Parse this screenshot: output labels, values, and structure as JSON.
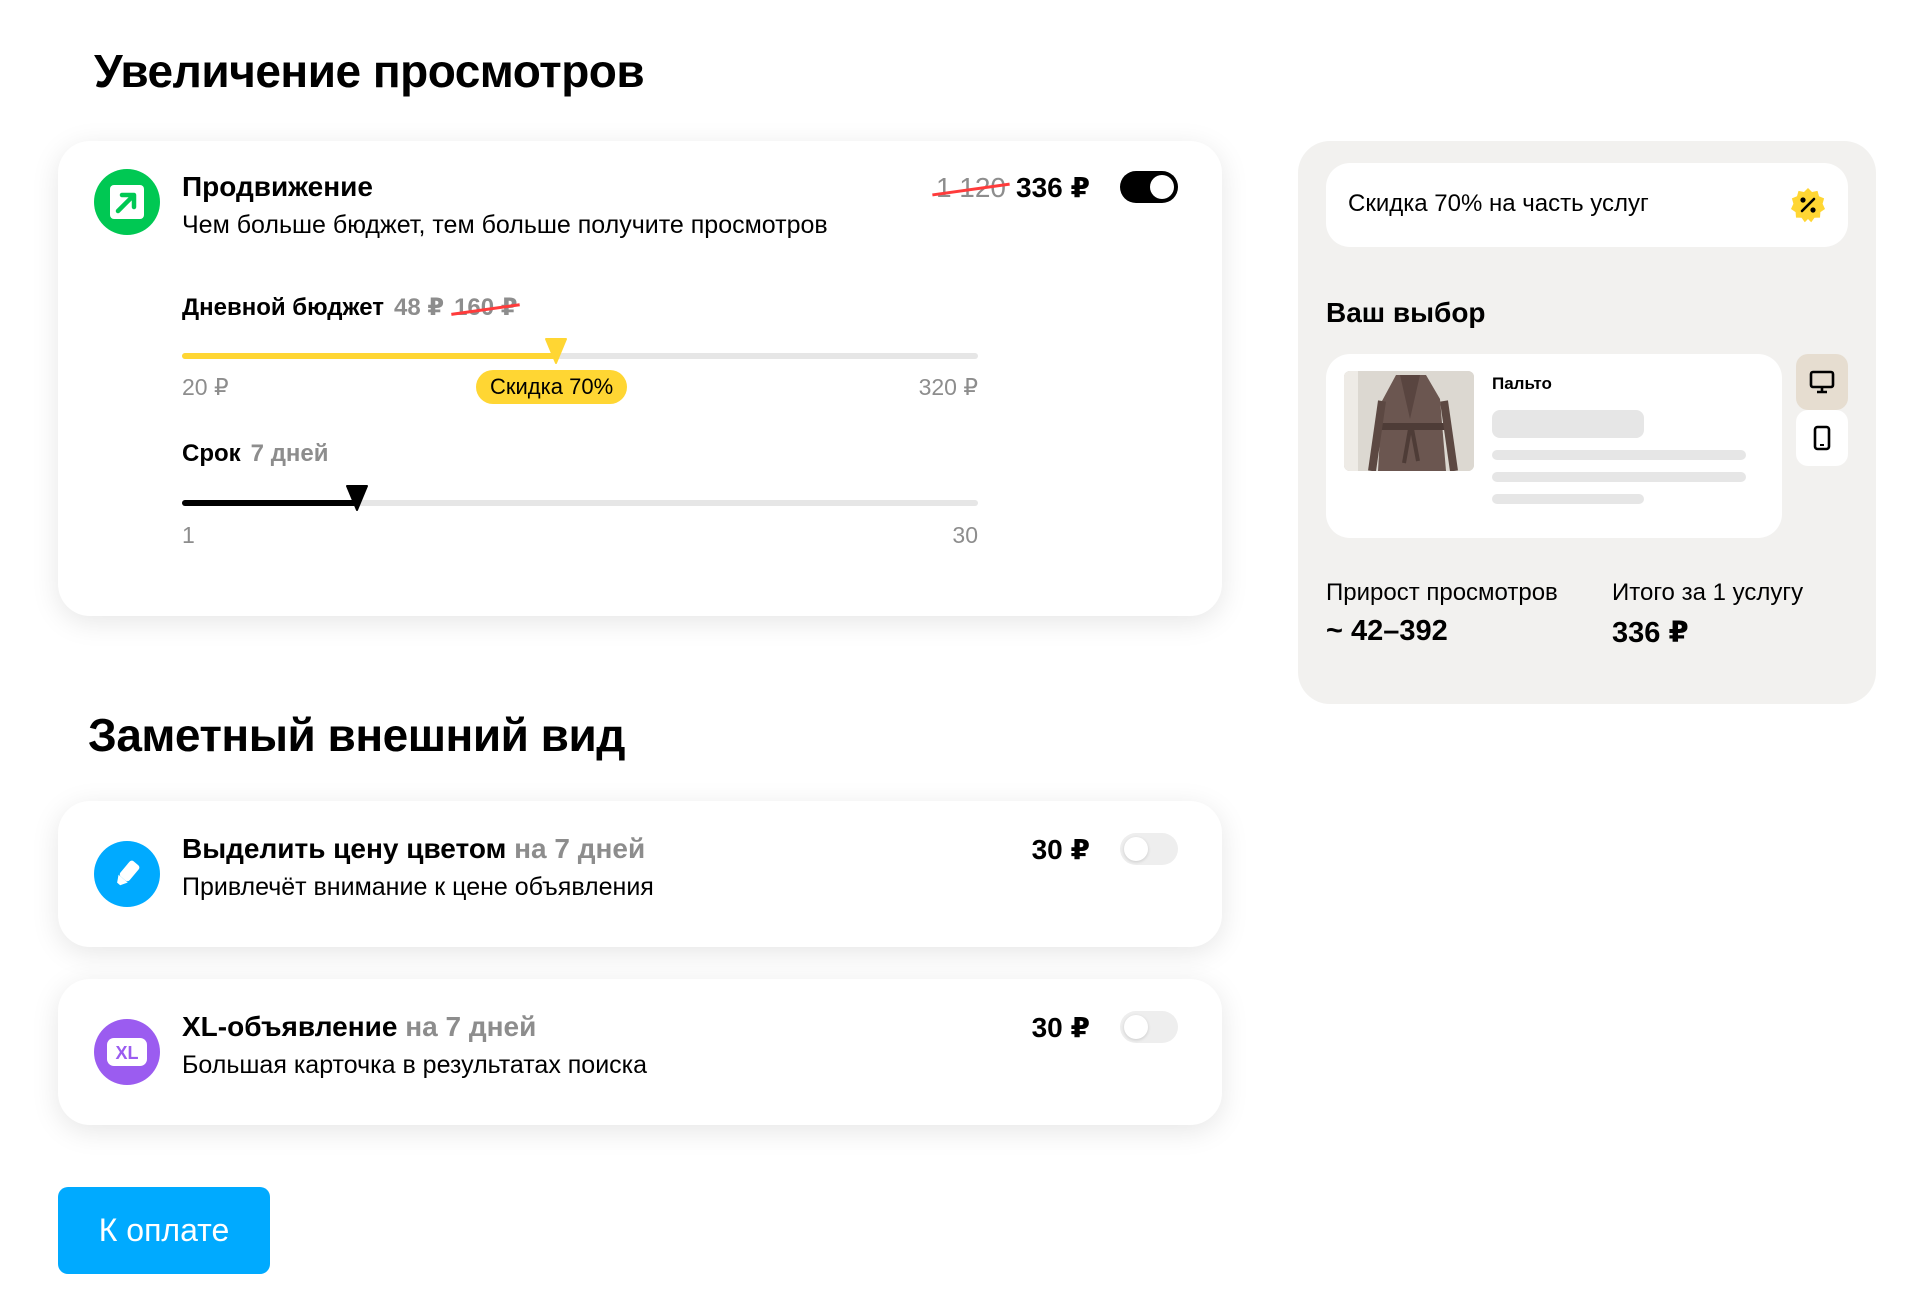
{
  "sections": {
    "views_title": "Увеличение просмотров",
    "look_title": "Заметный внешний вид"
  },
  "promotion": {
    "title": "Продвижение",
    "subtitle": "Чем больше бюджет, тем больше получите просмотров",
    "old_price": "1 120",
    "price": "336 ₽",
    "enabled": true,
    "budget": {
      "label": "Дневной бюджет",
      "value": "48 ₽",
      "old_value": "160 ₽",
      "min_label": "20 ₽",
      "max_label": "320 ₽",
      "level": 0.47,
      "discount_label": "Скидка 70%"
    },
    "term": {
      "label": "Срок",
      "value": "7 дней",
      "min_label": "1",
      "max_label": "30",
      "level": 0.22
    }
  },
  "price_color": {
    "title": "Выделить цену цветом",
    "duration": "на 7 дней",
    "subtitle": "Привлечёт внимание к цене объявления",
    "price": "30 ₽",
    "enabled": false
  },
  "xl": {
    "title": "XL-объявление",
    "duration": "на 7 дней",
    "subtitle": "Большая карточка в результатах поиска",
    "price": "30 ₽",
    "icon_text": "XL",
    "enabled": false
  },
  "summary": {
    "discount_text": "Скидка 70% на часть услуг",
    "choice_title": "Ваш выбор",
    "item_name": "Пальто",
    "views_growth_label": "Прирост просмотров",
    "views_growth_value": "~ 42–392",
    "total_label": "Итого за 1 услугу",
    "total_value": "336 ₽"
  },
  "pay_button": "К оплате",
  "colors": {
    "accent_blue": "#00aaff",
    "promo_green": "#00c853",
    "discount_yellow": "#ffd633",
    "xl_purple": "#9b5cf0",
    "strike_red": "#ff3b3b"
  },
  "icons": [
    "arrow-up-right-icon",
    "marker-icon",
    "xl-icon",
    "percent-badge-icon",
    "desktop-icon",
    "mobile-icon"
  ]
}
